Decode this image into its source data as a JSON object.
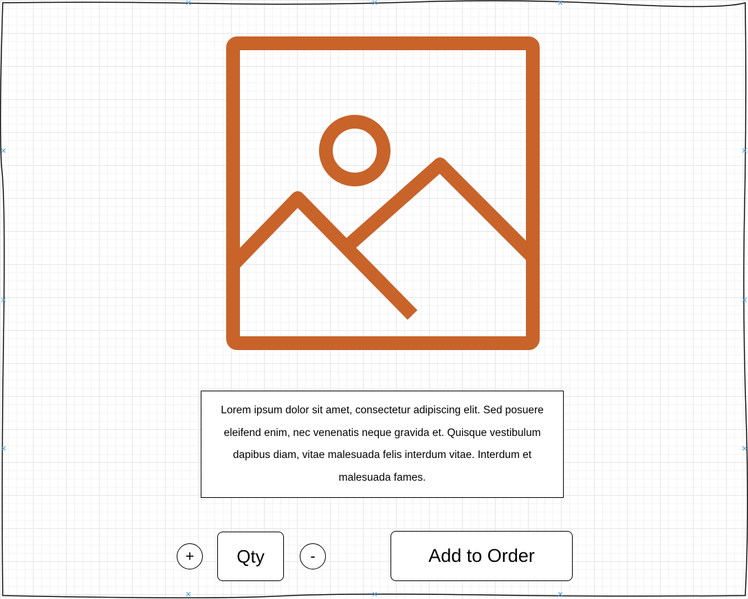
{
  "colors": {
    "icon_accent": "#c8632a",
    "handle": "#4a9fe0"
  },
  "product_image": {
    "icon": "image-placeholder-icon"
  },
  "description": {
    "text": "Lorem ipsum dolor sit amet, consectetur adipiscing elit. Sed posuere eleifend enim, nec venenatis neque gravida et. Quisque vestibulum dapibus diam, vitae malesuada felis interdum vitae. Interdum et malesuada fames."
  },
  "quantity": {
    "increase_label": "+",
    "field_label": "Qty",
    "decrease_label": "-"
  },
  "order": {
    "add_label": "Add to Order"
  }
}
